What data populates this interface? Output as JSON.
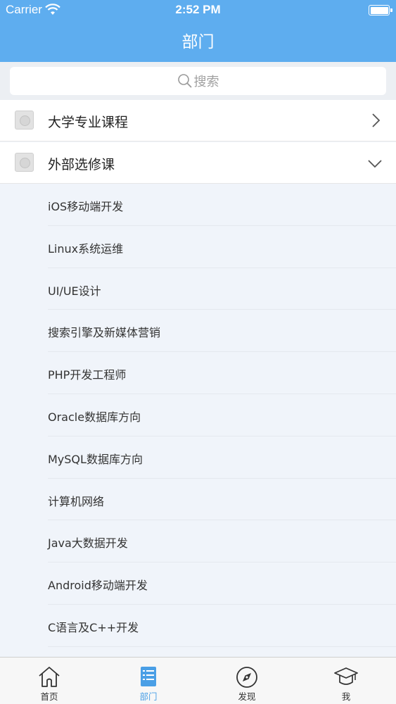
{
  "status_bar": {
    "carrier": "Carrier",
    "time": "2:52 PM"
  },
  "header": {
    "title": "部门"
  },
  "search": {
    "placeholder": "搜索"
  },
  "categories": [
    {
      "label": "大学专业课程",
      "expanded": false
    },
    {
      "label": "外部选修课",
      "expanded": true
    }
  ],
  "sub_items": [
    "iOS移动端开发",
    "Linux系统运维",
    "UI/UE设计",
    "搜索引擎及新媒体营销",
    "PHP开发工程师",
    "Oracle数据库方向",
    "MySQL数据库方向",
    "计算机网络",
    "Java大数据开发",
    "Android移动端开发",
    "C语言及C++开发"
  ],
  "tabbar": {
    "items": [
      {
        "label": "首页",
        "icon": "home-icon",
        "active": false
      },
      {
        "label": "部门",
        "icon": "list-icon",
        "active": true
      },
      {
        "label": "发现",
        "icon": "compass-icon",
        "active": false
      },
      {
        "label": "我",
        "icon": "graduation-cap-icon",
        "active": false
      }
    ]
  },
  "colors": {
    "accent": "#5eadef",
    "tab_active": "#4a9fe6"
  }
}
